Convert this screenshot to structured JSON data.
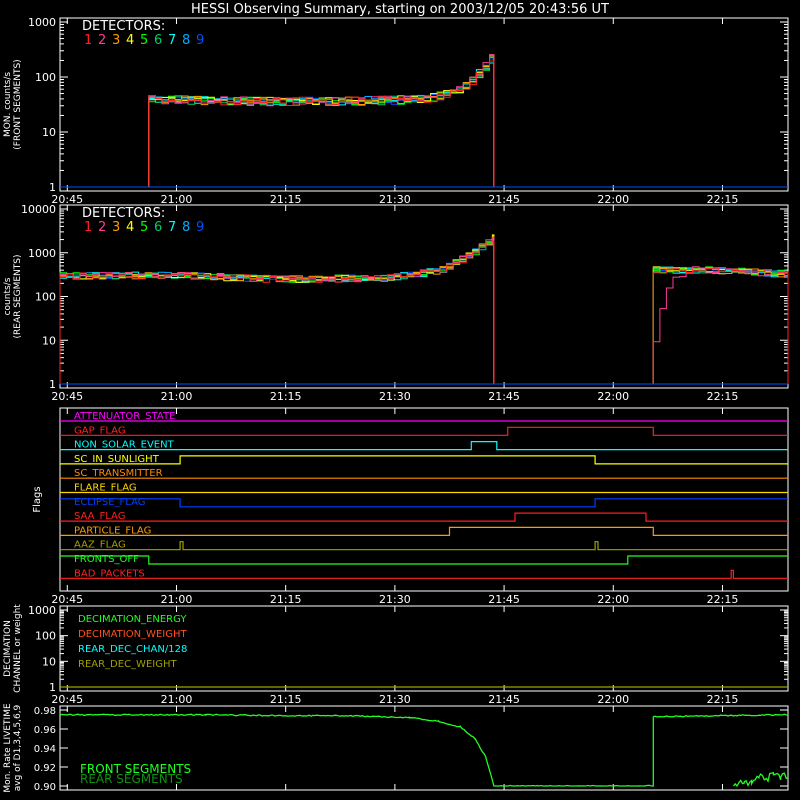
{
  "title": "HESSI Observing Summary, starting on 2003/12/05 20:43:56 UT",
  "colors": {
    "det": [
      "#ff2020",
      "#ff3a9a",
      "#ff9a00",
      "#ffff00",
      "#00ff00",
      "#00cc66",
      "#00ffff",
      "#00aaff",
      "#0050ff"
    ],
    "front": "#20ff20",
    "rear": "#109010",
    "axis": "#ffffff",
    "flag_default": "#ff2020"
  },
  "time_axis": {
    "start_minutes": 0,
    "end_minutes": 100,
    "ticks": [
      {
        "label": "20:45",
        "t": 1
      },
      {
        "label": "21:00",
        "t": 16
      },
      {
        "label": "21:15",
        "t": 31
      },
      {
        "label": "21:30",
        "t": 46
      },
      {
        "label": "21:45",
        "t": 61
      },
      {
        "label": "22:00",
        "t": 76
      },
      {
        "label": "22:15",
        "t": 91
      }
    ]
  },
  "chart_data": [
    {
      "type": "line",
      "ylabel": "MON. counts/s (FRONT SEGMENTS)",
      "ylabel_lines": [
        "MON. counts/s",
        "(FRONT SEGMENTS)"
      ],
      "yscale": "log",
      "ylim": [
        1,
        1000
      ],
      "yticks": [
        "1",
        "10",
        "100",
        "1000"
      ],
      "legend_title": "DETECTORS:",
      "legend": [
        "1",
        "2",
        "3",
        "4",
        "5",
        "6",
        "7",
        "8",
        "9"
      ],
      "segments": [
        [
          12.2,
          59.6
        ]
      ],
      "profile": [
        [
          12.2,
          40
        ],
        [
          20,
          38
        ],
        [
          30,
          36
        ],
        [
          40,
          37
        ],
        [
          50,
          40
        ],
        [
          55,
          60
        ],
        [
          58,
          150
        ],
        [
          59.6,
          270
        ]
      ]
    },
    {
      "type": "line",
      "ylabel": "counts/s (REAR SEGMENTS)",
      "ylabel_lines": [
        "counts/s",
        "(REAR SEGMENTS)"
      ],
      "yscale": "log",
      "ylim": [
        1,
        10000
      ],
      "yticks": [
        "1",
        "10",
        "100",
        "1000",
        "10000"
      ],
      "legend_title": "DETECTORS:",
      "legend": [
        "1",
        "2",
        "3",
        "4",
        "5",
        "6",
        "7",
        "8",
        "9"
      ],
      "segments": [
        [
          0,
          59.6
        ],
        [
          81.5,
          100
        ]
      ],
      "profile": [
        [
          0,
          300
        ],
        [
          15,
          310
        ],
        [
          30,
          250
        ],
        [
          45,
          270
        ],
        [
          52,
          400
        ],
        [
          56,
          900
        ],
        [
          59.6,
          2300
        ],
        [
          81.5,
          420
        ],
        [
          90,
          400
        ],
        [
          100,
          330
        ]
      ]
    },
    {
      "type": "step",
      "ylabel": "Flags",
      "flags": [
        {
          "name": "ATTENUATOR_STATE",
          "color": "#ff00ff",
          "steps": []
        },
        {
          "name": "GAP_FLAG",
          "color": "#ff2020",
          "steps": [
            [
              0,
              0
            ],
            [
              61.5,
              1
            ],
            [
              81.5,
              0
            ]
          ]
        },
        {
          "name": "NON_SOLAR_EVENT",
          "color": "#00ffff",
          "steps": [
            [
              0,
              0
            ],
            [
              56.5,
              1
            ],
            [
              60,
              0
            ]
          ]
        },
        {
          "name": "SC_IN_SUNLIGHT",
          "color": "#ffff00",
          "steps": [
            [
              0,
              0
            ],
            [
              16.5,
              1
            ],
            [
              73.5,
              0
            ]
          ]
        },
        {
          "name": "SC_TRANSMITTER",
          "color": "#ff8a00",
          "steps": []
        },
        {
          "name": "FLARE_FLAG",
          "color": "#ffd700",
          "steps": []
        },
        {
          "name": "ECLIPSE_FLAG",
          "color": "#0040ff",
          "steps": [
            [
              0,
              1
            ],
            [
              16.5,
              0
            ],
            [
              73.5,
              1
            ]
          ]
        },
        {
          "name": "SAA_FLAG",
          "color": "#ff2020",
          "steps": [
            [
              0,
              0
            ],
            [
              62.5,
              1
            ],
            [
              80.5,
              0
            ]
          ]
        },
        {
          "name": "PARTICLE_FLAG",
          "color": "#ff9a00",
          "steps": [
            [
              0,
              0
            ],
            [
              53.5,
              1
            ],
            [
              81.5,
              0
            ]
          ]
        },
        {
          "name": "AAZ_FLAG",
          "color": "#a0a000",
          "steps": [
            [
              0,
              0
            ],
            [
              16.5,
              1
            ],
            [
              16.9,
              0
            ],
            [
              73.5,
              1
            ],
            [
              73.9,
              0
            ]
          ]
        },
        {
          "name": "FRONTS_OFF",
          "color": "#20ff20",
          "steps": [
            [
              0,
              1
            ],
            [
              12.2,
              0
            ],
            [
              78,
              1
            ]
          ]
        },
        {
          "name": "BAD_PACKETS",
          "color": "#ff2020",
          "steps": [
            [
              0,
              0
            ],
            [
              92.2,
              1
            ],
            [
              92.5,
              0
            ]
          ]
        }
      ]
    },
    {
      "type": "line",
      "ylabel": "DECIMATION CHANNEL or weight",
      "ylabel_lines": [
        "DECIMATION",
        "CHANNEL or weight"
      ],
      "yscale": "log",
      "ylim": [
        1,
        1000
      ],
      "yticks": [
        "1",
        "10",
        "100",
        "1000"
      ],
      "legend": [
        {
          "name": "DECIMATION_ENERGY",
          "color": "#20ff20"
        },
        {
          "name": "DECIMATION_WEIGHT",
          "color": "#ff5020"
        },
        {
          "name": "REAR_DEC_CHAN/128",
          "color": "#00ffff"
        },
        {
          "name": "REAR_DEC_WEIGHT",
          "color": "#a0a000"
        }
      ]
    },
    {
      "type": "line",
      "ylabel": "Mon. Rate LIVETIME avg of D1,3,4,5,6,9",
      "ylabel_lines": [
        "Mon. Rate LIVETIME",
        "avg of D1,3,4,5,6,9"
      ],
      "yscale": "linear",
      "ylim": [
        0.9,
        0.98
      ],
      "yticks": [
        "0.90",
        "0.92",
        "0.94",
        "0.96",
        "0.98"
      ],
      "legend": [
        {
          "name": "FRONT SEGMENTS",
          "color": "#20ff20"
        },
        {
          "name": "REAR SEGMENTS",
          "color": "#109010"
        }
      ],
      "front": [
        [
          0,
          0.975
        ],
        [
          20,
          0.975
        ],
        [
          30,
          0.974
        ],
        [
          40,
          0.974
        ],
        [
          48,
          0.972
        ],
        [
          52,
          0.968
        ],
        [
          55,
          0.962
        ],
        [
          57,
          0.95
        ],
        [
          58.5,
          0.93
        ],
        [
          59.6,
          0.9
        ],
        [
          81.5,
          0.9
        ],
        [
          81.5,
          0.973
        ],
        [
          100,
          0.975
        ]
      ],
      "rear": [
        [
          92.5,
          0.9
        ],
        [
          94,
          0.905
        ],
        [
          95,
          0.902
        ],
        [
          96,
          0.91
        ],
        [
          97,
          0.906
        ],
        [
          98,
          0.915
        ],
        [
          99,
          0.91
        ],
        [
          100,
          0.912
        ]
      ]
    }
  ]
}
